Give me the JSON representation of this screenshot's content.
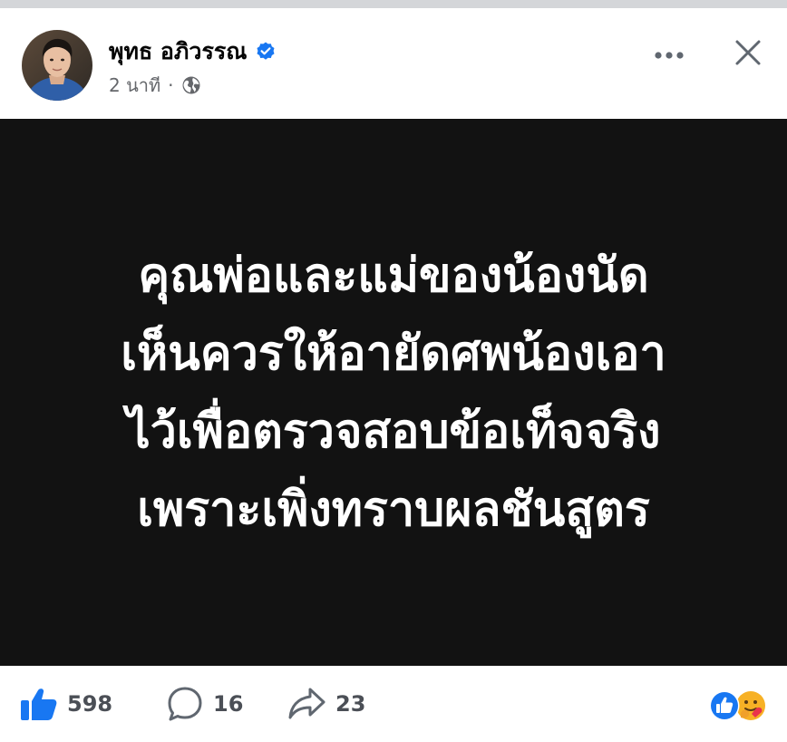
{
  "post": {
    "author_name": "พุทธ อภิวรรณ",
    "time": "2 นาที",
    "separator": "·",
    "icons": {
      "avatar": "avatar",
      "verified": "verified-badge-icon",
      "audience": "globe-icon",
      "more": "more-options-icon",
      "close": "close-icon"
    },
    "accent_color": "#1877f2"
  },
  "image_text": {
    "lines": [
      "คุณพ่อและแม่ของน้องนัด",
      "เห็นควรให้อายัดศพน้องเอา",
      "ไว้เพื่อตรวจสอบข้อเท็จจริง",
      "เพราะเพิ่งทราบผลชันสูตร"
    ],
    "background_color": "#121212",
    "text_color": "#ffffff"
  },
  "footer": {
    "likes": "598",
    "comments": "16",
    "shares": "23",
    "icons": {
      "like": "thumbs-up-icon",
      "comment": "comment-bubble-icon",
      "share": "share-arrow-icon",
      "reactions": [
        "like-reaction-icon",
        "care-reaction-icon"
      ]
    }
  }
}
